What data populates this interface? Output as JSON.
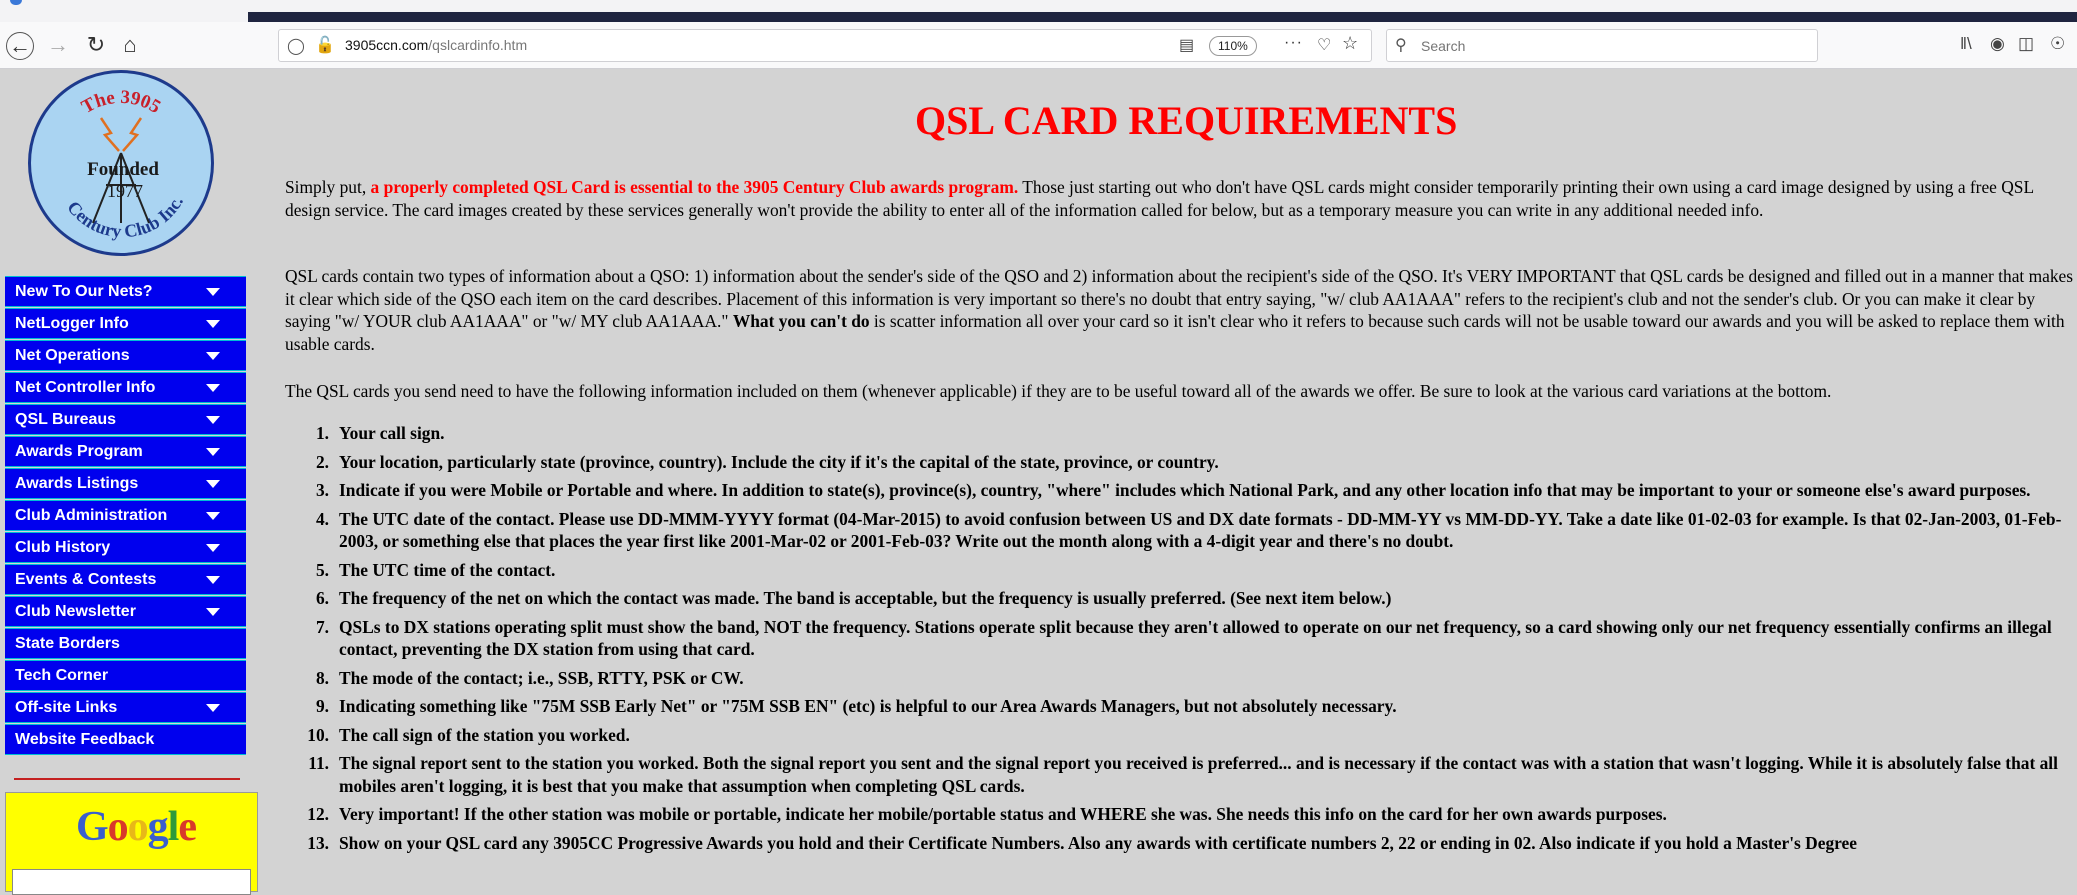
{
  "browser": {
    "url_domain": "3905ccn.com",
    "url_path": "/qslcardinfo.htm",
    "zoom": "110%",
    "search_placeholder": "Search"
  },
  "logo": {
    "arc_top": "The 3905",
    "founded": "Founded",
    "year": "1977",
    "arc_bottom": "Century Club Inc."
  },
  "sidebar": {
    "menu": [
      {
        "label": "New To Our Nets?",
        "has_dropdown": true
      },
      {
        "label": "NetLogger Info",
        "has_dropdown": true
      },
      {
        "label": "Net Operations",
        "has_dropdown": true
      },
      {
        "label": "Net Controller Info",
        "has_dropdown": true
      },
      {
        "label": "QSL Bureaus",
        "has_dropdown": true
      },
      {
        "label": "Awards Program",
        "has_dropdown": true
      },
      {
        "label": "Awards Listings",
        "has_dropdown": true
      },
      {
        "label": "Club Administration",
        "has_dropdown": true
      },
      {
        "label": "Club History",
        "has_dropdown": true
      },
      {
        "label": "Events & Contests",
        "has_dropdown": true
      },
      {
        "label": "Club Newsletter",
        "has_dropdown": true
      },
      {
        "label": "State Borders",
        "has_dropdown": false
      },
      {
        "label": "Tech Corner",
        "has_dropdown": false
      },
      {
        "label": "Off-site Links",
        "has_dropdown": true
      },
      {
        "label": "Website Feedback",
        "has_dropdown": false
      }
    ],
    "google_logo": "Google"
  },
  "main": {
    "title": "QSL CARD REQUIREMENTS",
    "p1": {
      "before": "Simply put, ",
      "highlight": "a properly completed QSL Card is essential to the 3905 Century Club awards program.",
      "after": "  Those just starting out who don't have QSL cards might consider temporarily printing their own using a card image designed by using a free QSL design service.  The card images created by these services generally won't provide the ability to enter all of the information called for below, but as a temporary measure you can write in any additional needed info."
    },
    "p2": {
      "before": "QSL cards contain two types of information about a QSO: 1) information about the sender's side of the QSO and 2) information about the recipient's side of the QSO.  It's VERY IMPORTANT that QSL cards be designed and filled out in a manner that makes it clear which side of the QSO each item on the card describes.  Placement of this information is very important so there's no doubt that entry saying, \"w/ club AA1AAA\" refers to the recipient's club and not the sender's club.  Or you can make it clear by saying \"w/ YOUR club AA1AAA\" or \"w/ MY club AA1AAA.\"  ",
      "bold": "What you can't do",
      "after": " is scatter information all over your card so it isn't clear who it refers to because such cards will not be usable toward our awards and you will be asked to replace them with usable cards."
    },
    "p3": "The QSL cards you send need to have the following information included on them (whenever applicable) if they are to be useful toward all of the awards we offer.  Be sure to look at the various card variations at the bottom.",
    "requirements": [
      {
        "num": "1.",
        "text": "Your call sign."
      },
      {
        "num": "2.",
        "text": "Your location, particularly state (province, country).  Include the city if it's the capital of the state, province, or country."
      },
      {
        "num": "3.",
        "text": "Indicate if you were Mobile or Portable and where.  In addition to state(s), province(s), country, \"where\" includes which National Park, and any other location info that may be important to your or someone else's award purposes."
      },
      {
        "num": "4.",
        "text": "The UTC date of the contact.  Please use DD-MMM-YYYY format (04-Mar-2015) to avoid confusion between US and DX date formats - DD-MM-YY vs MM-DD-YY.  Take a date like 01-02-03 for example.  Is that 02-Jan-2003, 01-Feb-2003, or something else that places the year first like 2001-Mar-02 or 2001-Feb-03?  Write out the month along with a 4-digit year and there's no doubt."
      },
      {
        "num": "5.",
        "text": "The UTC time of the contact."
      },
      {
        "num": "6.",
        "text": "The frequency of the net on which the contact was made.  The band is acceptable, but the frequency is usually preferred.  (See next item below.)"
      },
      {
        "num": "7.",
        "text": "QSLs to DX stations operating split must show the band, NOT the frequency.  Stations operate split because they aren't allowed to operate on our net frequency, so a card showing only our net frequency essentially confirms an illegal contact, preventing the DX station from using that card."
      },
      {
        "num": "8.",
        "text": "The mode of the contact; i.e., SSB, RTTY, PSK or CW."
      },
      {
        "num": "9.",
        "text": "Indicating something like \"75M SSB Early Net\" or \"75M SSB EN\" (etc) is helpful to our Area Awards Managers, but not absolutely necessary."
      },
      {
        "num": "10.",
        "text": "The call sign of the station you worked."
      },
      {
        "num": "11.",
        "text": "The signal report sent to the station you worked.  Both the signal report you sent and the signal report you received is preferred... and is necessary if the contact was with a station that wasn't logging.  While it is absolutely false that all mobiles aren't logging, it is best that you make that assumption when completing QSL cards."
      },
      {
        "num": "12.",
        "text": "Very important!  If the other station was mobile or portable, indicate her mobile/portable status and WHERE she was.  She needs this info on the card for her own awards purposes."
      },
      {
        "num": "13.",
        "text": "Show on your QSL card any 3905CC Progressive Awards you hold and their Certificate Numbers.  Also any awards with certificate numbers 2, 22 or ending in 02.  Also indicate if you hold a Master's Degree"
      }
    ]
  }
}
